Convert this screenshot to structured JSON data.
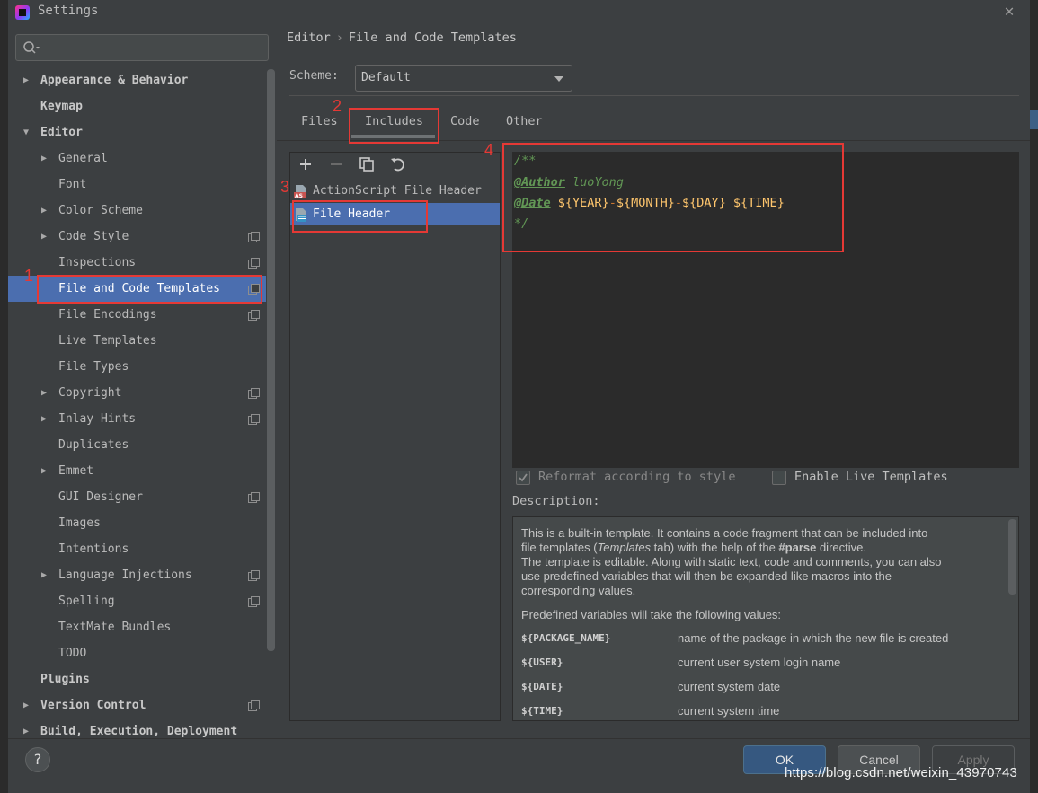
{
  "window": {
    "title": "Settings"
  },
  "breadcrumb": {
    "parent": "Editor",
    "separator": "›",
    "current": "File and Code Templates"
  },
  "scheme": {
    "label": "Scheme:",
    "value": "Default"
  },
  "tabs": [
    {
      "label": "Files"
    },
    {
      "label": "Includes",
      "active": true
    },
    {
      "label": "Code"
    },
    {
      "label": "Other"
    }
  ],
  "tree": [
    {
      "label": "Appearance & Behavior",
      "level": 0,
      "arrow": "▶"
    },
    {
      "label": "Keymap",
      "level": 0,
      "arrow": ""
    },
    {
      "label": "Editor",
      "level": 0,
      "arrow": "▼"
    },
    {
      "label": "General",
      "level": 1,
      "arrow": "▶"
    },
    {
      "label": "Font",
      "level": 1,
      "arrow": ""
    },
    {
      "label": "Color Scheme",
      "level": 1,
      "arrow": "▶"
    },
    {
      "label": "Code Style",
      "level": 1,
      "arrow": "▶",
      "project": true
    },
    {
      "label": "Inspections",
      "level": 1,
      "arrow": "",
      "project": true
    },
    {
      "label": "File and Code Templates",
      "level": 1,
      "arrow": "",
      "project": true,
      "selected": true
    },
    {
      "label": "File Encodings",
      "level": 1,
      "arrow": "",
      "project": true
    },
    {
      "label": "Live Templates",
      "level": 1,
      "arrow": ""
    },
    {
      "label": "File Types",
      "level": 1,
      "arrow": ""
    },
    {
      "label": "Copyright",
      "level": 1,
      "arrow": "▶",
      "project": true
    },
    {
      "label": "Inlay Hints",
      "level": 1,
      "arrow": "▶",
      "project": true
    },
    {
      "label": "Duplicates",
      "level": 1,
      "arrow": ""
    },
    {
      "label": "Emmet",
      "level": 1,
      "arrow": "▶"
    },
    {
      "label": "GUI Designer",
      "level": 1,
      "arrow": "",
      "project": true
    },
    {
      "label": "Images",
      "level": 1,
      "arrow": ""
    },
    {
      "label": "Intentions",
      "level": 1,
      "arrow": ""
    },
    {
      "label": "Language Injections",
      "level": 1,
      "arrow": "▶",
      "project": true
    },
    {
      "label": "Spelling",
      "level": 1,
      "arrow": "",
      "project": true
    },
    {
      "label": "TextMate Bundles",
      "level": 1,
      "arrow": ""
    },
    {
      "label": "TODO",
      "level": 1,
      "arrow": ""
    },
    {
      "label": "Plugins",
      "level": 0,
      "arrow": ""
    },
    {
      "label": "Version Control",
      "level": 0,
      "arrow": "▶",
      "project": true
    },
    {
      "label": "Build, Execution, Deployment",
      "level": 0,
      "arrow": "▶"
    }
  ],
  "templates": [
    {
      "label": "ActionScript File Header",
      "icon": "actionscript-file-icon"
    },
    {
      "label": "File Header",
      "icon": "file-template-icon",
      "selected": true
    }
  ],
  "toolbar": {
    "add": "+",
    "remove": "−",
    "copy": "copy-icon",
    "reset": "reset-icon"
  },
  "editor": {
    "line1": "/**",
    "author_tag": "@Author",
    "author_value": " luoYong",
    "date_tag": "@Date",
    "year": "${YEAR}",
    "dash1": "-",
    "month": "${MONTH}",
    "dash2": "-",
    "day": "${DAY}",
    "time": "${TIME}",
    "line4": "*/"
  },
  "options": {
    "reformat": "Reformat according to style",
    "reformat_checked": true,
    "live_templates": "Enable Live Templates",
    "live_templates_checked": false
  },
  "description": {
    "label": "Description:",
    "p1_l1": "This is a built-in template. It contains a code fragment that can be included into",
    "p1_l2a": "file templates (",
    "p1_l2_em": "Templates",
    "p1_l2b": " tab) with the help of the ",
    "p1_l2_strong": "#parse",
    "p1_l2c": " directive.",
    "p1_l3": "The template is editable. Along with static text, code and comments, you can also",
    "p1_l4": "use predefined variables that will then be expanded like macros into the",
    "p1_l5": "corresponding values.",
    "p2": "Predefined variables will take the following values:",
    "variables": [
      {
        "name": "${PACKAGE_NAME}",
        "desc": "name of the package in which the new file is created"
      },
      {
        "name": "${USER}",
        "desc": "current user system login name"
      },
      {
        "name": "${DATE}",
        "desc": "current system date"
      },
      {
        "name": "${TIME}",
        "desc": "current system time"
      }
    ]
  },
  "buttons": {
    "help": "?",
    "ok": "OK",
    "cancel": "Cancel",
    "apply": "Apply"
  },
  "annotations": [
    "1",
    "2",
    "3",
    "4"
  ],
  "watermark": "https://blog.csdn.net/weixin_43970743",
  "colors": {
    "selection": "#4b6eaf",
    "annotation": "#e53935",
    "ok_button": "#365880",
    "comment": "#629755",
    "template_var": "#ffc66d"
  }
}
